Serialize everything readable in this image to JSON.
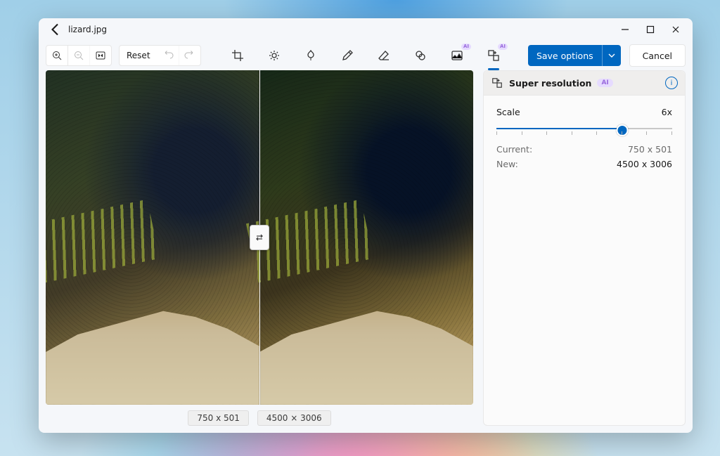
{
  "titlebar": {
    "filename": "lizard.jpg"
  },
  "toolbar": {
    "reset_label": "Reset",
    "save_label": "Save options",
    "cancel_label": "Cancel",
    "ai_badge_text": "AI"
  },
  "tools": {
    "crop": "Crop",
    "adjust": "Adjustment",
    "inpaint": "Retouch",
    "draw": "Markup",
    "erase": "Erase",
    "filters": "Filters",
    "bg_ai": "Background AI",
    "superres_ai": "Super resolution AI"
  },
  "comparison": {
    "left_dim": "750 x 501",
    "right_dim": "4500 × 3006"
  },
  "panel": {
    "title": "Super resolution",
    "ai_pill": "AI",
    "scale_label": "Scale",
    "scale_value_text": "6x",
    "scale_value": 6,
    "scale_max": 8,
    "current_label": "Current:",
    "current_value": "750 x 501",
    "new_label": "New:",
    "new_value": "4500 x 3006"
  }
}
